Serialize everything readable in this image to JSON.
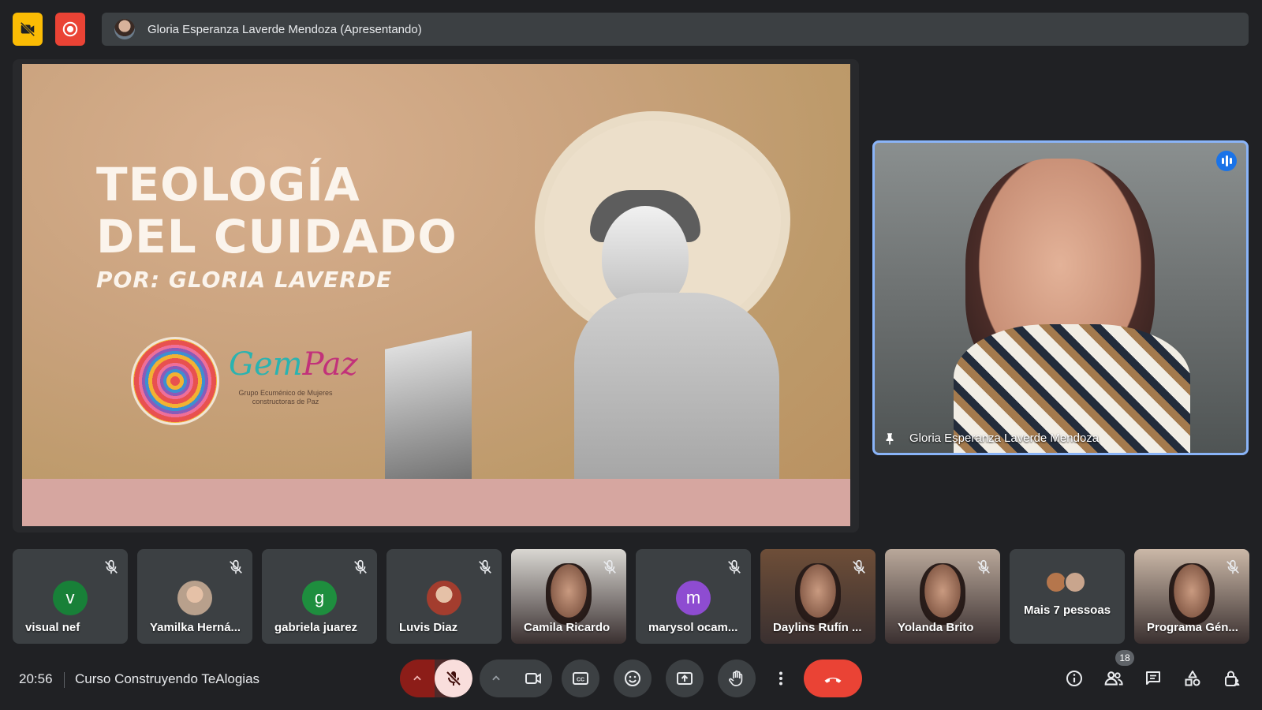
{
  "top_bar": {
    "presenter_text": "Gloria Esperanza Laverde Mendoza (Apresentando)"
  },
  "slide": {
    "title_line1": "TEOLOGÍA",
    "title_line2": "DEL CUIDADO",
    "subtitle": "POR: GLORIA LAVERDE",
    "logo_name_part1": "Gem",
    "logo_name_part2": "Paz",
    "logo_caption": "Grupo Ecuménico de Mujeres constructoras de Paz"
  },
  "speaker": {
    "name": "Gloria Esperanza Laverde Mendoza"
  },
  "participants": [
    {
      "name": "visual nef",
      "initial": "v",
      "color": "#188038",
      "type": "initial"
    },
    {
      "name": "Yamilka Herná...",
      "initial": "",
      "color": "#b8a08c",
      "type": "photo"
    },
    {
      "name": "gabriela juarez",
      "initial": "g",
      "color": "#1e8e3e",
      "type": "initial"
    },
    {
      "name": "Luvis Diaz",
      "initial": "",
      "color": "#a33d2e",
      "type": "photo"
    },
    {
      "name": "Camila Ricardo",
      "initial": "",
      "color": "#d9d7d2",
      "type": "video"
    },
    {
      "name": "marysol ocam...",
      "initial": "m",
      "color": "#8e4cd1",
      "type": "initial"
    },
    {
      "name": "Daylins Rufín ...",
      "initial": "",
      "color": "#6e4e38",
      "type": "video"
    },
    {
      "name": "Yolanda Brito",
      "initial": "",
      "color": "#b9a89a",
      "type": "video"
    },
    {
      "name": "Mais 7 pessoas",
      "initial": "",
      "color": "#3c4043",
      "type": "more"
    },
    {
      "name": "Programa Gén...",
      "initial": "",
      "color": "#cbb8a8",
      "type": "video"
    }
  ],
  "bottom_bar": {
    "time": "20:56",
    "meeting_name": "Curso Construyendo TeAlogias",
    "participant_count": "18"
  },
  "colors": {
    "background": "#202124",
    "accent_blue": "#8ab4f8",
    "end_call": "#ea4335",
    "recording": "#ea4335",
    "warning": "#fbbc04"
  }
}
